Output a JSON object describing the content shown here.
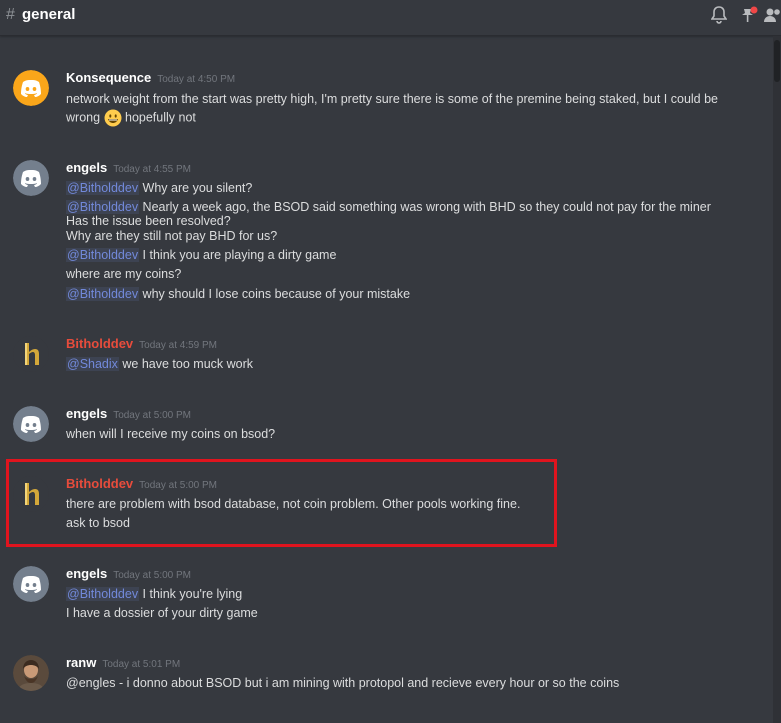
{
  "channel": {
    "hash": "#",
    "name": "general"
  },
  "colors": {
    "mention": "#7289da",
    "bithold_name": "#e74c3c",
    "highlight": "#e0141e"
  },
  "messages": [
    {
      "author": "Konsequence",
      "time": "Today at 4:50 PM",
      "avatar": "discord-yellow",
      "lines": [
        [
          {
            "t": "network weight from the start was pretty high, I'm pretty sure there is some of the premine being staked, but I could be"
          }
        ],
        [
          {
            "t": "wrong "
          },
          {
            "emoji": "grinning-emoji"
          },
          {
            "t": " hopefully not"
          }
        ]
      ]
    },
    {
      "author": "engels",
      "time": "Today at 4:55 PM",
      "avatar": "discord-gray",
      "lines": [
        [
          {
            "m": "@Bitholddev"
          },
          {
            "t": " Why are you silent?"
          }
        ],
        [
          {
            "m": "@Bitholddev"
          },
          {
            "t": " Nearly a week ago, the BSOD said something was wrong with BHD so they could not pay for the miner"
          }
        ],
        [
          {
            "t": "Has the issue been resolved?"
          }
        ],
        [
          {
            "t": "Why are they still not pay BHD for us?"
          }
        ],
        [
          {
            "m": "@Bitholddev"
          },
          {
            "t": " I think you are playing a dirty game"
          }
        ],
        [
          {
            "t": "where are my coins?"
          }
        ],
        [
          {
            "m": "@Bitholddev"
          },
          {
            "t": " why should I lose coins because of your mistake"
          }
        ]
      ]
    },
    {
      "author": "Bitholddev",
      "time": "Today at 4:59 PM",
      "avatar": "h-logo",
      "lines": [
        [
          {
            "m": "@Shadix"
          },
          {
            "t": " we have too muck work"
          }
        ]
      ]
    },
    {
      "author": "engels",
      "time": "Today at 5:00 PM",
      "avatar": "discord-gray",
      "lines": [
        [
          {
            "t": "when will I receive my coins on bsod?"
          }
        ]
      ]
    },
    {
      "author": "Bitholddev",
      "time": "Today at 5:00 PM",
      "avatar": "h-logo",
      "lines": [
        [
          {
            "t": "there are problem with bsod database, not coin problem. Other pools working fine."
          }
        ],
        [
          {
            "t": "ask to bsod"
          }
        ]
      ]
    },
    {
      "author": "engels",
      "time": "Today at 5:00 PM",
      "avatar": "discord-gray",
      "lines": [
        [
          {
            "m": "@Bitholddev"
          },
          {
            "t": " I think you're lying"
          }
        ],
        [
          {
            "t": "I have a dossier of your dirty game"
          }
        ]
      ]
    },
    {
      "author": "ranw",
      "time": "Today at 5:01 PM",
      "avatar": "photo",
      "lines": [
        [
          {
            "t": "@engles - i donno about BSOD but i am mining with protopol and recieve every hour or so the coins"
          }
        ]
      ]
    }
  ]
}
